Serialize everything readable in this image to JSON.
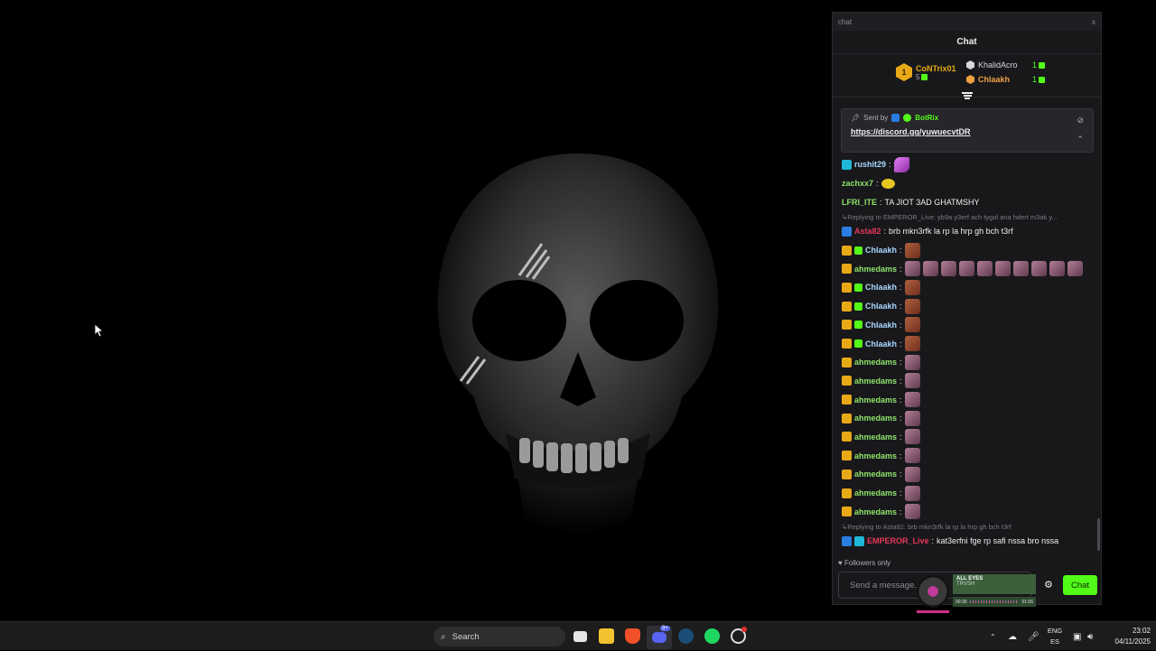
{
  "window": {
    "title": "chat",
    "close_label": "x",
    "header": "Chat"
  },
  "leaderboard": {
    "first": {
      "rank": "1",
      "name": "CoNTrix01",
      "gifts": "5"
    },
    "others": [
      {
        "name": "KhalidAcro",
        "count": "1",
        "color": "#d6d6dc"
      },
      {
        "name": "Chlaakh",
        "count": "1",
        "color": "#f0a040"
      }
    ]
  },
  "pinned": {
    "sent_by_label": "Sent by",
    "sender": "BotRix",
    "link": "https://discord.gg/yuwuecvtDR"
  },
  "messages": [
    {
      "kind": "msg",
      "user": "rushit29",
      "color": "#a8d8ff",
      "badges": [
        "grid"
      ],
      "text": "",
      "emotes": [
        "feather"
      ]
    },
    {
      "kind": "msg",
      "user": "zachxx7",
      "color": "#8fe36b",
      "badges": [],
      "text": "",
      "emotes": [
        "yellow"
      ]
    },
    {
      "kind": "msg",
      "user": "LFRI_ITE",
      "color": "#8fe36b",
      "badges": [],
      "text": "TA JIOT 3AD GHATMSHY",
      "emotes": []
    },
    {
      "kind": "reply",
      "text": "Replying to EMPEROR_Live: yb9a y3erf ach tygol ana hdert m3ak y..."
    },
    {
      "kind": "msg",
      "user": "Asta82",
      "color": "#e8365b",
      "badges": [
        "blue"
      ],
      "text": "brb mkn3rfk la rp la hrp gh bch t3rf",
      "emotes": []
    },
    {
      "kind": "msg",
      "user": "Chlaakh",
      "color": "#a8d8ff",
      "badges": [
        "crown",
        "gift"
      ],
      "text": "",
      "emotes": [
        "face"
      ]
    },
    {
      "kind": "msg",
      "user": "ahmedams",
      "color": "#8fe36b",
      "badges": [
        "crown"
      ],
      "text": "",
      "emotes": [
        "pink",
        "pink",
        "pink",
        "pink",
        "pink",
        "pink",
        "pink",
        "pink",
        "pink",
        "pink"
      ]
    },
    {
      "kind": "msg",
      "user": "Chlaakh",
      "color": "#a8d8ff",
      "badges": [
        "crown",
        "gift"
      ],
      "text": "",
      "emotes": [
        "face"
      ]
    },
    {
      "kind": "msg",
      "user": "Chlaakh",
      "color": "#a8d8ff",
      "badges": [
        "crown",
        "gift"
      ],
      "text": "",
      "emotes": [
        "face"
      ]
    },
    {
      "kind": "msg",
      "user": "Chlaakh",
      "color": "#a8d8ff",
      "badges": [
        "crown",
        "gift"
      ],
      "text": "",
      "emotes": [
        "face"
      ]
    },
    {
      "kind": "msg",
      "user": "Chlaakh",
      "color": "#a8d8ff",
      "badges": [
        "crown",
        "gift"
      ],
      "text": "",
      "emotes": [
        "face"
      ]
    },
    {
      "kind": "msg",
      "user": "ahmedams",
      "color": "#8fe36b",
      "badges": [
        "crown"
      ],
      "text": "",
      "emotes": [
        "pink"
      ]
    },
    {
      "kind": "msg",
      "user": "ahmedams",
      "color": "#8fe36b",
      "badges": [
        "crown"
      ],
      "text": "",
      "emotes": [
        "pink"
      ]
    },
    {
      "kind": "msg",
      "user": "ahmedams",
      "color": "#8fe36b",
      "badges": [
        "crown"
      ],
      "text": "",
      "emotes": [
        "pink"
      ]
    },
    {
      "kind": "msg",
      "user": "ahmedams",
      "color": "#8fe36b",
      "badges": [
        "crown"
      ],
      "text": "",
      "emotes": [
        "pink"
      ]
    },
    {
      "kind": "msg",
      "user": "ahmedams",
      "color": "#8fe36b",
      "badges": [
        "crown"
      ],
      "text": "",
      "emotes": [
        "pink"
      ]
    },
    {
      "kind": "msg",
      "user": "ahmedams",
      "color": "#8fe36b",
      "badges": [
        "crown"
      ],
      "text": "",
      "emotes": [
        "pink"
      ]
    },
    {
      "kind": "msg",
      "user": "ahmedams",
      "color": "#8fe36b",
      "badges": [
        "crown"
      ],
      "text": "",
      "emotes": [
        "pink"
      ]
    },
    {
      "kind": "msg",
      "user": "ahmedams",
      "color": "#8fe36b",
      "badges": [
        "crown"
      ],
      "text": "",
      "emotes": [
        "pink"
      ]
    },
    {
      "kind": "msg",
      "user": "ahmedams",
      "color": "#8fe36b",
      "badges": [
        "crown"
      ],
      "text": "",
      "emotes": [
        "pink"
      ]
    },
    {
      "kind": "reply",
      "text": "Replying to Asta82: brb mkn3rfk la rp la hrp gh bch t3rf"
    },
    {
      "kind": "msg",
      "user": "EMPEROR_Live",
      "color": "#e8365b",
      "badges": [
        "blue",
        "grid"
      ],
      "text": "kat3erfni fge rp safi nssa bro nssa",
      "emotes": []
    }
  ],
  "footer": {
    "followers_only": "Followers only",
    "placeholder": "Send a message...",
    "send_label": "Chat"
  },
  "media": {
    "title": "ALL EYES",
    "artist": "TRVSH",
    "elapsed": "00:30",
    "duration": "01:06"
  },
  "taskbar": {
    "search_label": "Search",
    "lang_top": "ENG",
    "lang_bottom": "ES",
    "time": "23:02",
    "date": "04/11/2025",
    "discord_badge": "9+"
  },
  "colors": {
    "kick_green": "#53fc18",
    "panel_bg": "#18181b",
    "taskbar_bg": "#1c1c1c"
  }
}
